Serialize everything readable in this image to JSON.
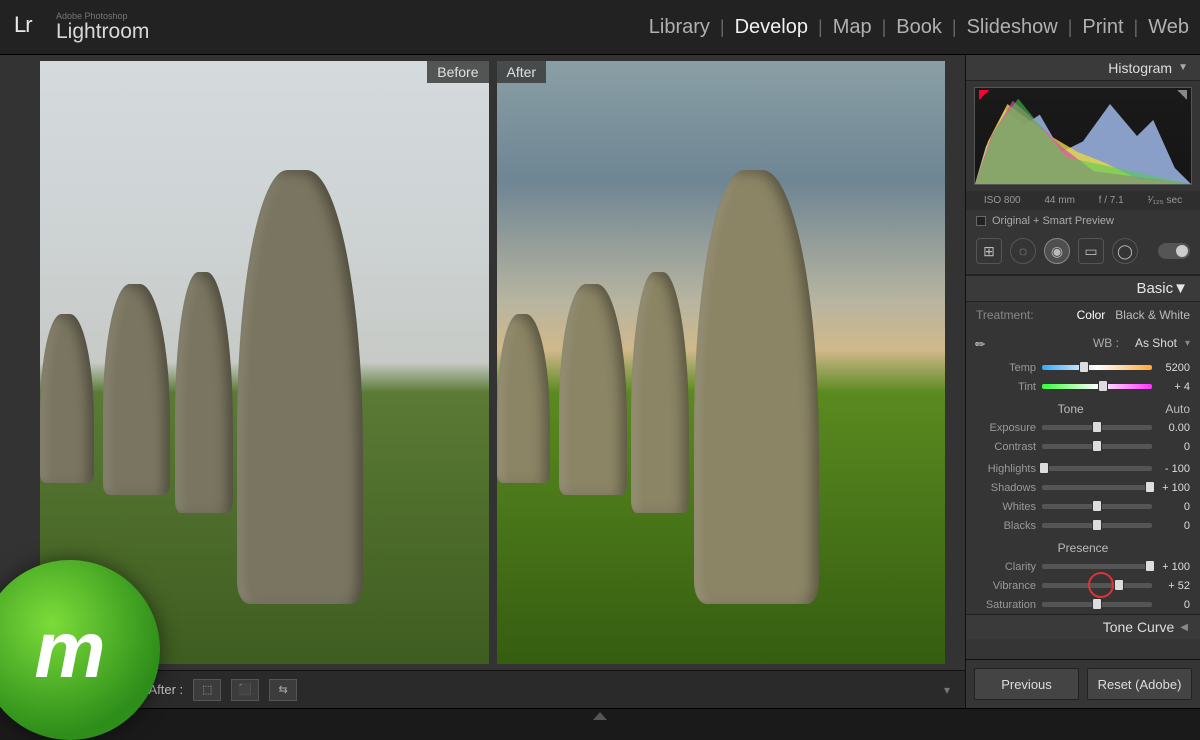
{
  "brand": {
    "small": "Adobe Photoshop",
    "big": "Lightroom",
    "icon": "Lr"
  },
  "modules": [
    "Library",
    "Develop",
    "Map",
    "Book",
    "Slideshow",
    "Print",
    "Web"
  ],
  "active_module": "Develop",
  "compare": {
    "before": "Before",
    "after": "After"
  },
  "viewer_bar": {
    "mode_label": "Before & After :"
  },
  "panels": {
    "histogram": {
      "title": "Histogram",
      "meta": {
        "iso": "ISO 800",
        "focal": "44 mm",
        "aperture": "f / 7.1",
        "shutter": "¹⁄₁₂₅ sec"
      },
      "preview": "Original + Smart Preview"
    },
    "basic": {
      "title": "Basic",
      "treatment": {
        "label": "Treatment:",
        "options": [
          "Color",
          "Black & White"
        ],
        "active": "Color"
      },
      "wb": {
        "label": "WB :",
        "preset": "As Shot"
      },
      "sliders": {
        "temp": {
          "label": "Temp",
          "value": "5200",
          "pos": 38
        },
        "tint": {
          "label": "Tint",
          "value": "+ 4",
          "pos": 55
        },
        "exposure": {
          "label": "Exposure",
          "value": "0.00",
          "pos": 50
        },
        "contrast": {
          "label": "Contrast",
          "value": "0",
          "pos": 50
        },
        "highlights": {
          "label": "Highlights",
          "value": "- 100",
          "pos": 2
        },
        "shadows": {
          "label": "Shadows",
          "value": "+ 100",
          "pos": 98
        },
        "whites": {
          "label": "Whites",
          "value": "0",
          "pos": 50
        },
        "blacks": {
          "label": "Blacks",
          "value": "0",
          "pos": 50
        },
        "clarity": {
          "label": "Clarity",
          "value": "+ 100",
          "pos": 98
        },
        "vibrance": {
          "label": "Vibrance",
          "value": "+ 52",
          "pos": 70
        },
        "saturation": {
          "label": "Saturation",
          "value": "0",
          "pos": 50
        }
      },
      "tone_label": "Tone",
      "auto_label": "Auto",
      "presence_label": "Presence"
    },
    "tonecurve": {
      "title": "Tone Curve"
    }
  },
  "footer": {
    "prev": "Previous",
    "reset": "Reset (Adobe)"
  },
  "blob": "m"
}
